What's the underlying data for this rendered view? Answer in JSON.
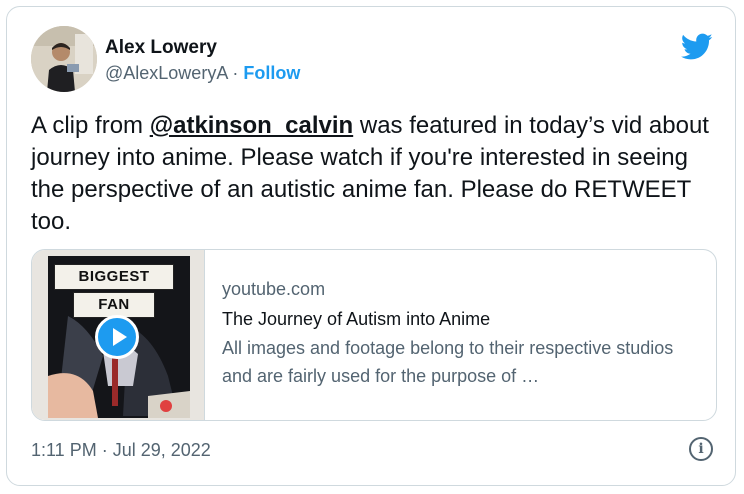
{
  "author": {
    "name": "Alex Lowery",
    "handle": "@AlexLoweryA",
    "separator": " · ",
    "follow_label": "Follow"
  },
  "tweet": {
    "text_before": "A clip from ",
    "mention": "@atkinson_calvin",
    "text_after": " was featured in today’s vid about journey into anime. Please watch if you're interested in seeing the perspective of an autistic anime fan. Please do RETWEET too."
  },
  "card": {
    "thumbnail_label_1": "BIGGEST",
    "thumbnail_label_2": "FAN",
    "domain": "youtube.com",
    "title": "The Journey of Autism into Anime",
    "description": "All images and footage belong to their respective studios and are fairly used for the purpose of …"
  },
  "footer": {
    "timestamp": "1:11 PM · Jul 29, 2022",
    "info_glyph": "i"
  },
  "colors": {
    "accent": "#1d9bf0",
    "text_primary": "#0f1419",
    "text_secondary": "#536471",
    "border": "#cfd9de"
  },
  "icons": [
    "avatar-photo",
    "twitter-bird-icon",
    "play-icon",
    "info-icon"
  ]
}
